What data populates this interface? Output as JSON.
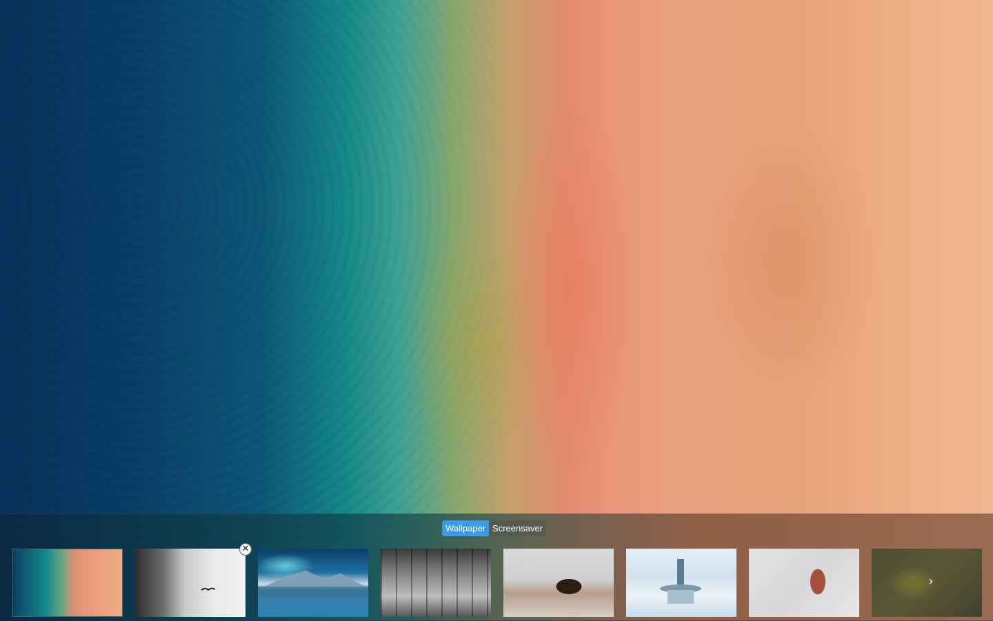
{
  "desktop": {
    "wallpaper_name": "aerial-beach"
  },
  "mode_switch": {
    "wallpaper_label": "Wallpaper",
    "screensaver_label": "Screensaver",
    "selected": "Wallpaper"
  },
  "thumbnails": [
    {
      "subject": "aerial beach",
      "current": true
    },
    {
      "subject": "foggy cliff with bird",
      "removable": true
    },
    {
      "subject": "aurora over mountain lake"
    },
    {
      "subject": "black and white workshop"
    },
    {
      "subject": "bald eagle in snow"
    },
    {
      "subject": "snowy park fountain"
    },
    {
      "subject": "frosted leaf"
    },
    {
      "subject": "hummingbird"
    }
  ],
  "icons": {
    "close": "close-icon",
    "next": "chevron-right-icon"
  },
  "glyphs": {
    "close": "✕",
    "next": "›"
  },
  "colors": {
    "accent": "#3a9be8"
  }
}
